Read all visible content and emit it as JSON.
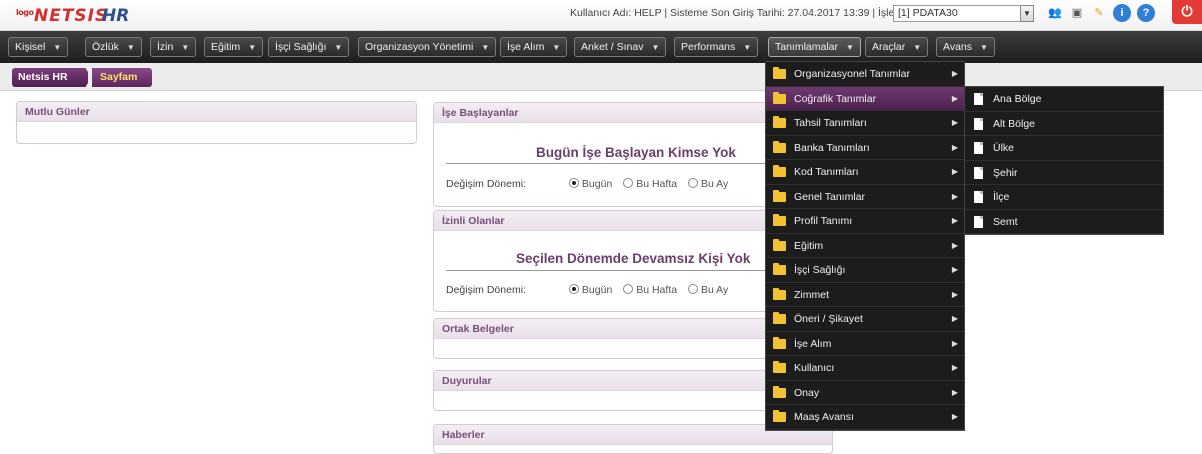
{
  "header": {
    "logo_small": "logo",
    "logo_main": "NETSIS",
    "logo_hr": "HR",
    "user_info": "Kullanıcı Adı: HELP | Sisteme Son Giriş Tarihi: 27.04.2017 13:39 | İşletme:",
    "company_value": "[1] PDATA30"
  },
  "nav": {
    "items": [
      {
        "label": "Kişisel"
      },
      {
        "label": "Özlük"
      },
      {
        "label": "İzin"
      },
      {
        "label": "Eğitim"
      },
      {
        "label": "İşçi Sağlığı"
      },
      {
        "label": "Organizasyon Yönetimi"
      },
      {
        "label": "İşe Alım"
      },
      {
        "label": "Anket / Sınav"
      },
      {
        "label": "Performans"
      },
      {
        "label": "Tanımlamalar"
      },
      {
        "label": "Araçlar"
      },
      {
        "label": "Avans"
      }
    ]
  },
  "breadcrumb": {
    "home": "Netsis HR",
    "current": "Sayfam"
  },
  "panels": {
    "mutlu_gunler": {
      "title": "Mutlu Günler"
    },
    "ise_baslayanlar": {
      "title": "İşe Başlayanlar",
      "message": "Bugün İşe Başlayan Kimse Yok",
      "period_label": "Değişim Dönemi:",
      "options": [
        "Bugün",
        "Bu Hafta",
        "Bu Ay"
      ]
    },
    "izinli_olanlar": {
      "title": "İzinli Olanlar",
      "message": "Seçilen Dönemde Devamsız Kişi Yok",
      "period_label": "Değişim Dönemi:",
      "options": [
        "Bugün",
        "Bu Hafta",
        "Bu Ay"
      ]
    },
    "ortak_belgeler": {
      "title": "Ortak Belgeler"
    },
    "duyurular": {
      "title": "Duyurular"
    },
    "haberler": {
      "title": "Haberler"
    }
  },
  "tanimlamalar_menu": {
    "items": [
      {
        "label": "Organizasyonel Tanımlar"
      },
      {
        "label": "Coğrafik Tanımlar"
      },
      {
        "label": "Tahsil Tanımları"
      },
      {
        "label": "Banka Tanımları"
      },
      {
        "label": "Kod Tanımları"
      },
      {
        "label": "Genel Tanımlar"
      },
      {
        "label": "Profil Tanımı"
      },
      {
        "label": "Eğitim"
      },
      {
        "label": "İşçi Sağlığı"
      },
      {
        "label": "Zimmet"
      },
      {
        "label": "Öneri / Şikayet"
      },
      {
        "label": "İşe Alım"
      },
      {
        "label": "Kullanıcı"
      },
      {
        "label": "Onay"
      },
      {
        "label": "Maaş Avansı"
      }
    ]
  },
  "cografik_menu": {
    "items": [
      {
        "label": "Ana Bölge"
      },
      {
        "label": "Alt Bölge"
      },
      {
        "label": "Ülke"
      },
      {
        "label": "Şehir"
      },
      {
        "label": "İlçe"
      },
      {
        "label": "Semt"
      }
    ]
  },
  "colors": {
    "brand_red": "#d32f2f",
    "accent_purple": "#6b3f6b",
    "menu_bg": "#1c1c1c"
  }
}
